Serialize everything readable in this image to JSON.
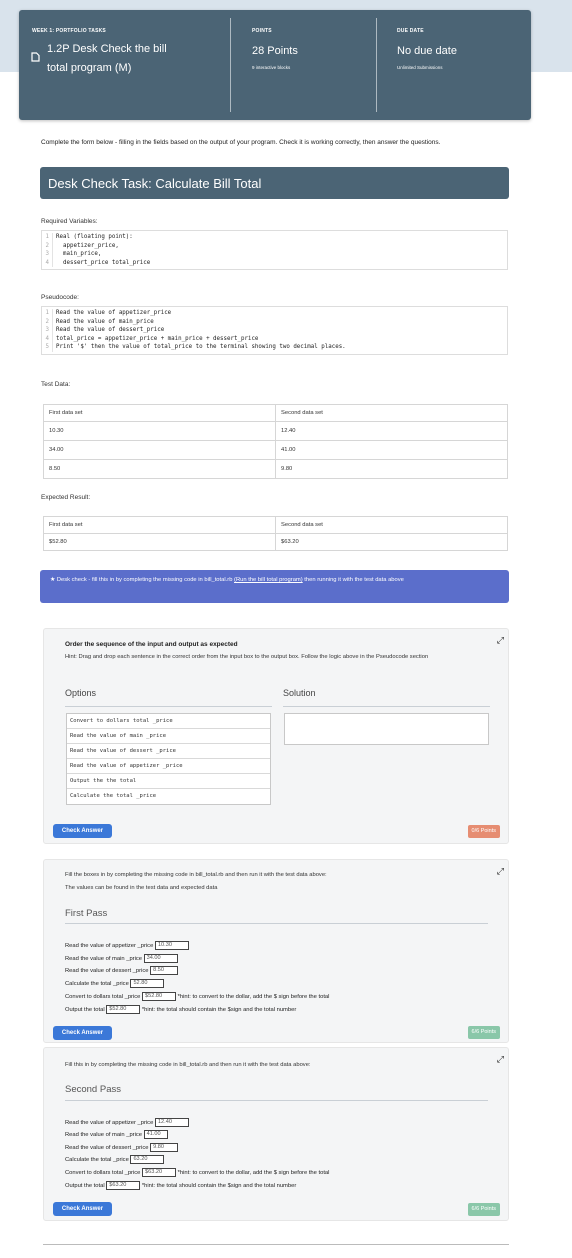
{
  "header": {
    "col1": {
      "label": "WEEK 1: PORTFOLIO TASKS",
      "title_line1": "1.2P Desk Check the bill",
      "title_line2": "total program (M)"
    },
    "col2": {
      "label": "POINTS",
      "value": "28 Points",
      "sub": "9 interactive blocks"
    },
    "col3": {
      "label": "DUE DATE",
      "value": "No due date",
      "sub": "Unlimited Submissions"
    }
  },
  "intro": "Complete the form below - filling in the fields based on the output of your program. Check it is working correctly, then answer the questions.",
  "task_title": "Desk Check Task: Calculate Bill Total",
  "required_vars": {
    "label": "Required Variables:",
    "lines": [
      "Real (floating point):",
      "  appetizer_price,",
      "  main_price,",
      "  dessert_price total_price"
    ]
  },
  "pseudocode": {
    "label": "Pseudocode:",
    "lines": [
      "Read the value of appetizer_price",
      "Read the value of main_price",
      "Read the value of dessert_price",
      "total_price = appetizer_price + main_price + dessert_price",
      "Print '$' then the value of total_price to the terminal showing two decimal places."
    ]
  },
  "test_data": {
    "label": "Test Data:",
    "headers": [
      "First data set",
      "Second data set"
    ],
    "rows": [
      [
        "10.30",
        "12.40"
      ],
      [
        "34.00",
        "41.00"
      ],
      [
        "8.50",
        "9.80"
      ]
    ]
  },
  "expected": {
    "label": "Expected Result:",
    "headers": [
      "First data set",
      "Second data set"
    ],
    "values": [
      "$52.80",
      "$63.20"
    ]
  },
  "note": {
    "star": "★",
    "text_before": "Desk check - fill this in by completing the missing code in bill_total.rb ",
    "link": "(Run the bill total program)",
    "text_after": " then running it with the test data above"
  },
  "order_panel": {
    "title": "Order the sequence of the input and output as expected",
    "hint": "Hint: Drag and drop each sentence in the correct order from the input box to the output box. Follow the logic above in the Pseudocode section",
    "options_label": "Options",
    "solution_label": "Solution",
    "options": [
      "Convert to dollars total _price",
      "Read the value of main _price",
      "Read the value of dessert _price",
      "Read the value of appetizer _price",
      "Output the the total",
      "Calculate the total _price"
    ],
    "button": "Check Answer",
    "points": "0/6 Points"
  },
  "first_pass": {
    "intro1": "Fill the boxes in by completing the missing code in bill_total.rb and then run it with the test data above:",
    "intro2": "The values can be found in the test data and expected data",
    "title": "First Pass",
    "rows": [
      {
        "label": "Read the value of appetizer _price",
        "value": "10.30",
        "hint": ""
      },
      {
        "label": "Read the value of main _price",
        "value": "34.00",
        "hint": ""
      },
      {
        "label": "Read the value of dessert _price",
        "value": "8.50",
        "hint": ""
      },
      {
        "label": "Calculate the total _price",
        "value": "52.80",
        "hint": ""
      },
      {
        "label": "Convert to dollars total _price",
        "value": "$52.80",
        "hint": "*hint: to convert to the dollar, add the $ sign before the total"
      },
      {
        "label": "Output the total",
        "value": "$52.80",
        "hint": "*hint: the total should contain the $sign and the total number"
      }
    ],
    "button": "Check Answer",
    "points": "6/6 Points"
  },
  "second_pass": {
    "intro1": "Fill this in by completing the missing code in bill_total.rb and then run it with the test data above:",
    "title": "Second Pass",
    "rows": [
      {
        "label": "Read the value of appetizer _price",
        "value": "12.40",
        "hint": ""
      },
      {
        "label": "Read the value of main _price",
        "value": "41.00",
        "hint": ""
      },
      {
        "label": "Read the value of dessert _price",
        "value": "9.80",
        "hint": ""
      },
      {
        "label": "Calculate the total _price",
        "value": "63.20",
        "hint": ""
      },
      {
        "label": "Convert to dollars total _price",
        "value": "$63.20",
        "hint": "*hint: to convert to the dollar, add the $ sign before the total"
      },
      {
        "label": "Output the total",
        "value": "$63.20",
        "hint": "*hint: the total should contain the $sign and the total number"
      }
    ],
    "button": "Check Answer",
    "points": "6/6 Points"
  },
  "colors": {
    "header": "#4b6475",
    "note": "#5b6ecb",
    "button": "#3b78d8",
    "points_red": "#e68d72",
    "points_green": "#8ac7a9"
  },
  "icons": {
    "page": "page-icon",
    "expand": "expand-icon",
    "star": "star-icon"
  }
}
